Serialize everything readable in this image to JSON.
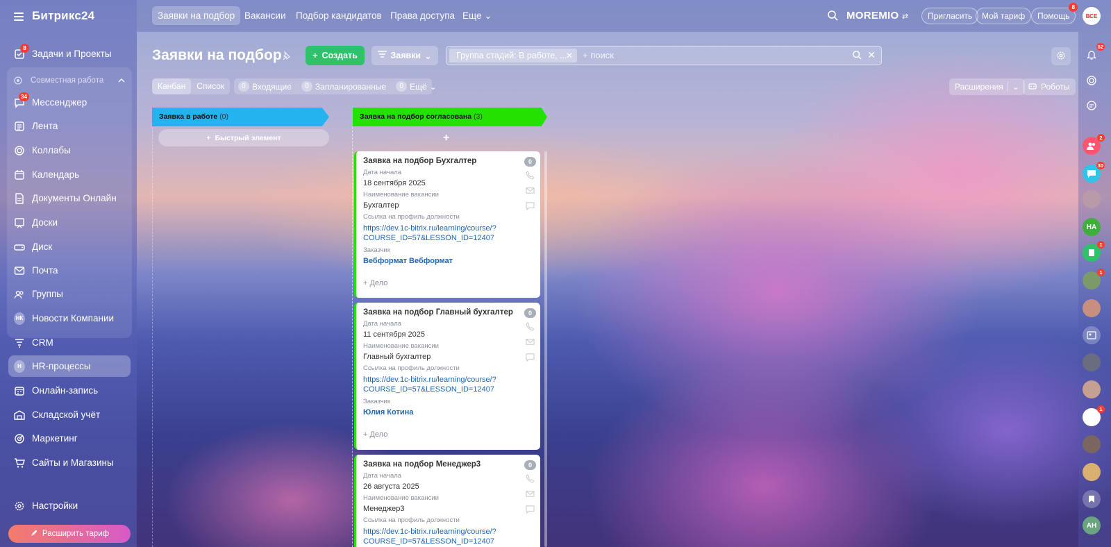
{
  "sidebar": {
    "logo": "Битрикс24",
    "group_title": "Совместная работа",
    "items": [
      {
        "label": "Задачи и Проекты",
        "badge": "8"
      },
      {
        "label": "Мессенджер",
        "badge": "34"
      },
      {
        "label": "Лента"
      },
      {
        "label": "Коллабы"
      },
      {
        "label": "Календарь"
      },
      {
        "label": "Документы Онлайн"
      },
      {
        "label": "Доски"
      },
      {
        "label": "Диск"
      },
      {
        "label": "Почта"
      },
      {
        "label": "Группы"
      },
      {
        "label": "Новости Компании",
        "avatar": "НК"
      },
      {
        "label": "CRM"
      },
      {
        "label": "HR-процессы",
        "avatar": "H"
      },
      {
        "label": "Онлайн-запись"
      },
      {
        "label": "Складской учёт"
      },
      {
        "label": "Маркетинг"
      },
      {
        "label": "Сайты и Магазины"
      },
      {
        "label": "Настройки"
      }
    ],
    "upgrade": "Расширить тариф"
  },
  "topbar": {
    "tabs": [
      "Заявки на подбор",
      "Вакансии",
      "Подбор кандидатов",
      "Права доступа",
      "Еще"
    ],
    "brand": "MOREMIO",
    "invite": "Пригласить",
    "tariff": "Мой тариф",
    "help": "Помощь",
    "help_badge": "8"
  },
  "header": {
    "title": "Заявки на подбор",
    "create": "Создать",
    "entity": "Заявки",
    "filter_chip": "Группа стадий: В работе, ...",
    "search_placeholder": "+ поиск"
  },
  "toolbar": {
    "views": [
      "Канбан",
      "Список"
    ],
    "counters": [
      {
        "count": "0",
        "label": "Входящие"
      },
      {
        "count": "0",
        "label": "Запланированные"
      },
      {
        "count": "0",
        "label": "Ещё"
      }
    ],
    "extensions": "Расширения",
    "robots": "Роботы"
  },
  "kanban": {
    "columns": [
      {
        "title": "Заявка в работе",
        "count": "(0)",
        "quick_add": "Быстрый элемент"
      },
      {
        "title": "Заявка на подбор согласована",
        "count": "(3)"
      }
    ],
    "field_labels": {
      "start": "Дата начала",
      "vacancy": "Наименование вакансии",
      "profile": "Ссылка на профиль должности",
      "client": "Заказчик",
      "deal": "+ Дело"
    },
    "cards": [
      {
        "title": "Заявка на подбор Бухгалтер",
        "count": "0",
        "start": "18 сентября 2025",
        "vacancy": "Бухгалтер",
        "link1": "https://dev.1c-bitrix.ru/learning/course/?",
        "link2": "COURSE_ID=57&LESSON_ID=12407",
        "client": "Вебформат Вебформат"
      },
      {
        "title": "Заявка на подбор Главный бухгалтер",
        "count": "0",
        "start": "11 сентября 2025",
        "vacancy": "Главный бухгалтер",
        "link1": "https://dev.1c-bitrix.ru/learning/course/?",
        "link2": "COURSE_ID=57&LESSON_ID=12407",
        "client": "Юлия Котина"
      },
      {
        "title": "Заявка на подбор Менеджер3",
        "count": "0",
        "start": "26 августа 2025",
        "vacancy": "Менеджер3",
        "link1": "https://dev.1c-bitrix.ru/learning/course/?",
        "link2": "COURSE_ID=57&LESSON_ID=12407"
      }
    ]
  },
  "rail": {
    "top_avatar": "ВСЕ",
    "bell_badge": "82",
    "badges": [
      "2",
      "30",
      "1",
      "1",
      "1",
      "1"
    ],
    "initials": [
      "НА",
      "АН"
    ]
  },
  "colors": {
    "create_green": "#2fc26b",
    "col1_blue": "#23b4f0",
    "col2_green": "#23e100",
    "link_blue": "#2066b0",
    "badge_red": "#ff3b30"
  }
}
